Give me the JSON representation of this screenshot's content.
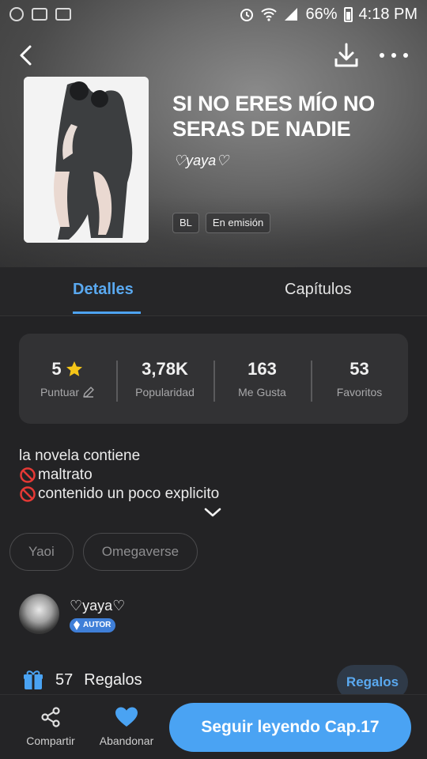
{
  "status_bar": {
    "battery": "66%",
    "time": "4:18 PM"
  },
  "book": {
    "title": "SI NO ERES MÍO NO SERAS DE NADIE",
    "author": "♡yaya♡",
    "tags": [
      "BL",
      "En emisión"
    ]
  },
  "tabs": [
    {
      "label": "Detalles",
      "active": true
    },
    {
      "label": "Capítulos",
      "active": false
    }
  ],
  "stats": [
    {
      "value": "5",
      "label": "Puntuar"
    },
    {
      "value": "3,78K",
      "label": "Popularidad"
    },
    {
      "value": "163",
      "label": "Me Gusta"
    },
    {
      "value": "53",
      "label": "Favoritos"
    }
  ],
  "description": {
    "line1": "la novela contiene",
    "line2": "maltrato",
    "line3": "contenido un poco explicito"
  },
  "genres": [
    "Yaoi",
    "Omegaverse"
  ],
  "author_card": {
    "name": "♡yaya♡",
    "badge": "AUTOR"
  },
  "gifts": {
    "count": "57",
    "label": "Regalos",
    "button": "Regalos"
  },
  "bottom_bar": {
    "share": "Compartir",
    "abandon": "Abandonar",
    "cta": "Seguir leyendo Cap.17"
  },
  "colors": {
    "accent": "#4aa3f3",
    "background": "#232325",
    "card": "#323234",
    "star": "#f5c518",
    "prohibited": "#e53935"
  }
}
